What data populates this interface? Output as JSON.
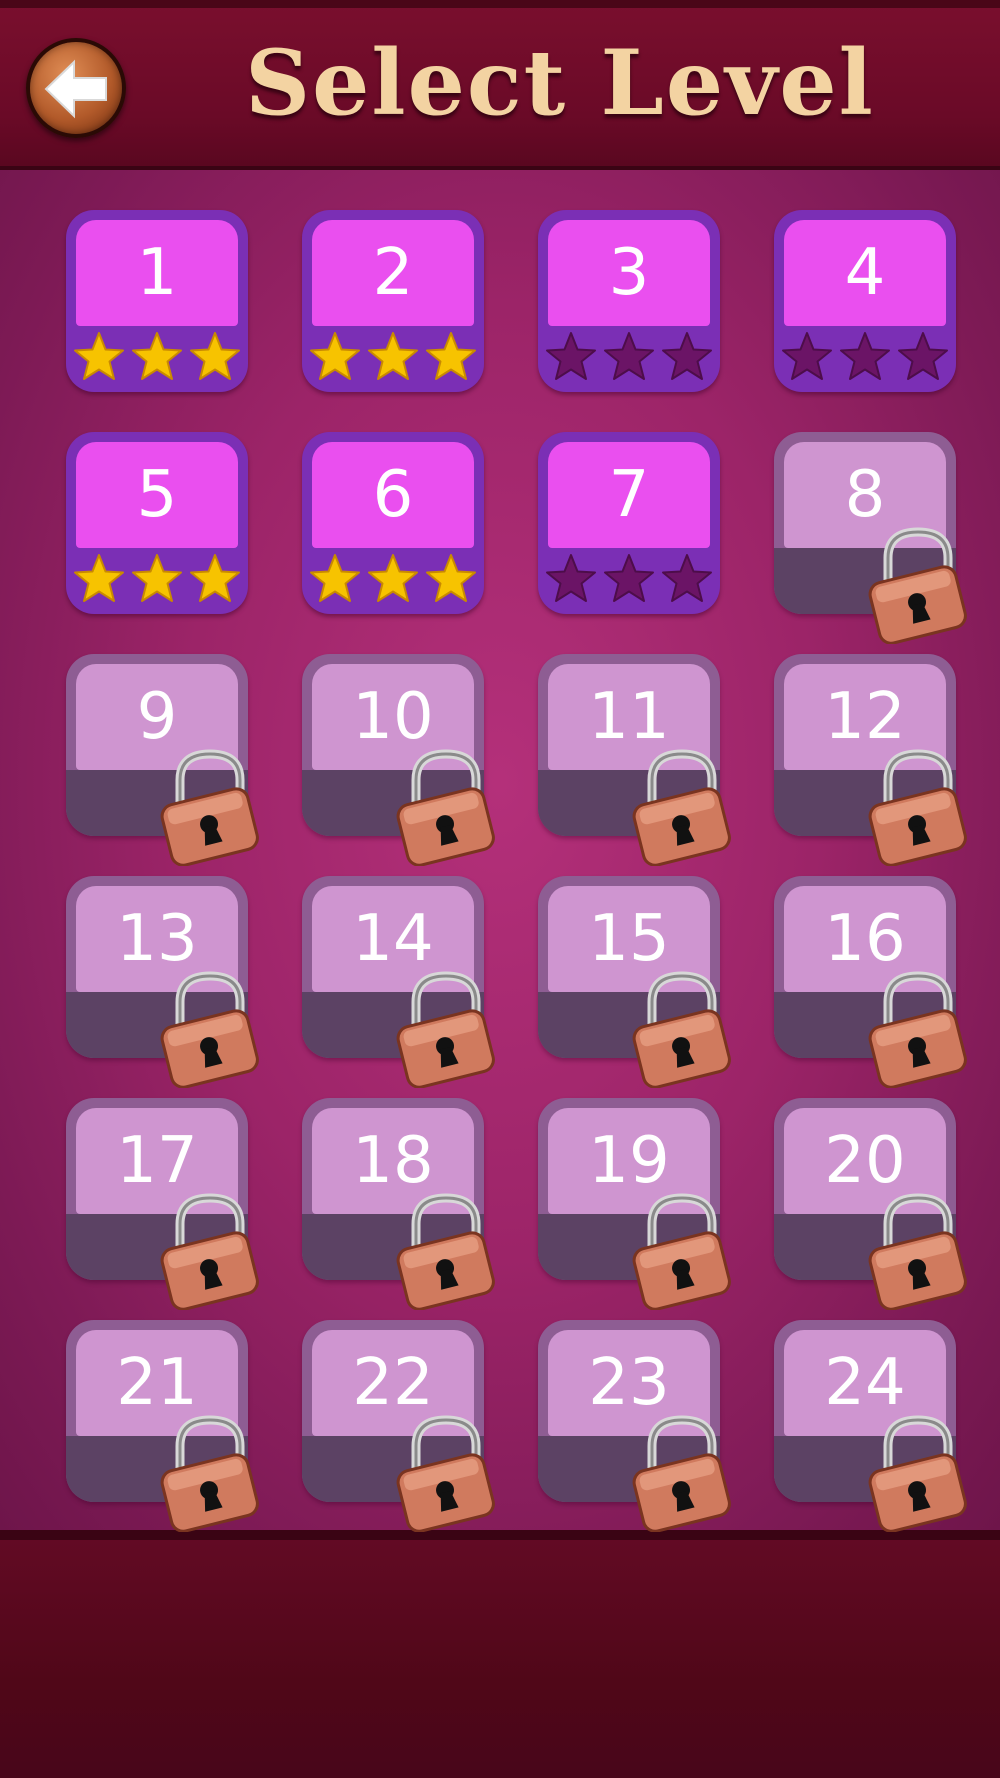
{
  "header": {
    "title": "Select Level",
    "back_icon": "back-arrow-icon"
  },
  "colors": {
    "header": "#6a0a27",
    "board": "#9c2468",
    "tile_unlocked": "#ea4fef",
    "tile_unlocked_frame": "#7b2fb5",
    "tile_locked": "#cf95d0",
    "star_gold": "#f7c300",
    "star_empty": "#6b1466",
    "title_text": "#f3d3a2"
  },
  "levels": [
    {
      "number": "1",
      "locked": false,
      "stars": 3
    },
    {
      "number": "2",
      "locked": false,
      "stars": 3
    },
    {
      "number": "3",
      "locked": false,
      "stars": 0
    },
    {
      "number": "4",
      "locked": false,
      "stars": 0
    },
    {
      "number": "5",
      "locked": false,
      "stars": 3
    },
    {
      "number": "6",
      "locked": false,
      "stars": 3
    },
    {
      "number": "7",
      "locked": false,
      "stars": 0
    },
    {
      "number": "8",
      "locked": true
    },
    {
      "number": "9",
      "locked": true
    },
    {
      "number": "10",
      "locked": true
    },
    {
      "number": "11",
      "locked": true
    },
    {
      "number": "12",
      "locked": true
    },
    {
      "number": "13",
      "locked": true
    },
    {
      "number": "14",
      "locked": true
    },
    {
      "number": "15",
      "locked": true
    },
    {
      "number": "16",
      "locked": true
    },
    {
      "number": "17",
      "locked": true
    },
    {
      "number": "18",
      "locked": true
    },
    {
      "number": "19",
      "locked": true
    },
    {
      "number": "20",
      "locked": true
    },
    {
      "number": "21",
      "locked": true
    },
    {
      "number": "22",
      "locked": true
    },
    {
      "number": "23",
      "locked": true
    },
    {
      "number": "24",
      "locked": true
    }
  ]
}
